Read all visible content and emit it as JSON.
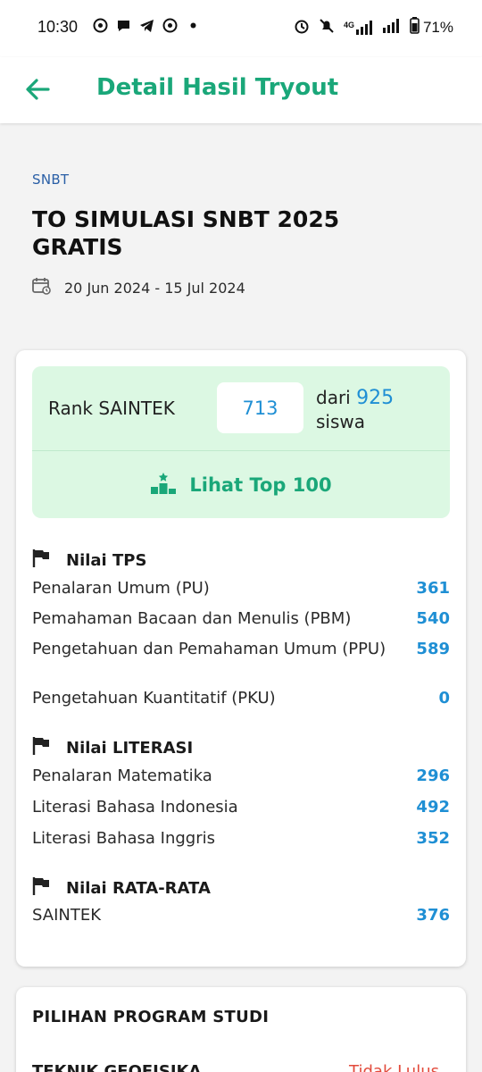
{
  "status_bar": {
    "time": "10:30",
    "notification_icons": [
      "whatsapp-icon",
      "chat-bubble-icon",
      "telegram-icon",
      "whatsapp-icon",
      "dot-icon"
    ],
    "network_label": "4G",
    "battery": "71%"
  },
  "app_bar": {
    "title": "Detail Hasil Tryout"
  },
  "tryout": {
    "category": "SNBT",
    "title": "TO SIMULASI SNBT 2025 GRATIS",
    "date_range": "20 Jun 2024 - 15 Jul 2024"
  },
  "rank": {
    "label": "Rank SAINTEK",
    "value": "713",
    "dari_label": "dari",
    "total": "925",
    "unit": "siswa",
    "top100_label": "Lihat Top 100"
  },
  "sections": [
    {
      "title": "Nilai TPS",
      "rows": [
        {
          "label": "Penalaran Umum (PU)",
          "value": "361"
        },
        {
          "label": "Pemahaman Bacaan dan Menulis (PBM)",
          "value": "540"
        },
        {
          "label": "Pengetahuan dan Pemahaman Umum (PPU)",
          "value": "589"
        },
        {
          "label": "Pengetahuan Kuantitatif (PKU)",
          "value": "0"
        }
      ]
    },
    {
      "title": "Nilai LITERASI",
      "rows": [
        {
          "label": "Penalaran Matematika",
          "value": "296"
        },
        {
          "label": "Literasi Bahasa Indonesia",
          "value": "492"
        },
        {
          "label": "Literasi Bahasa Inggris",
          "value": "352"
        }
      ]
    },
    {
      "title": "Nilai RATA-RATA",
      "rows": [
        {
          "label": "SAINTEK",
          "value": "376"
        }
      ]
    }
  ],
  "program": {
    "title": "PILIHAN PROGRAM STUDI",
    "first_item": "TEKNIK GEOFISIKA",
    "first_status": "Tidak Lulus"
  },
  "colors": {
    "accent": "#1aa779",
    "value_blue": "#1f8fd4",
    "rank_bg": "#dcf8e3",
    "fail_red": "#e24a3b"
  }
}
